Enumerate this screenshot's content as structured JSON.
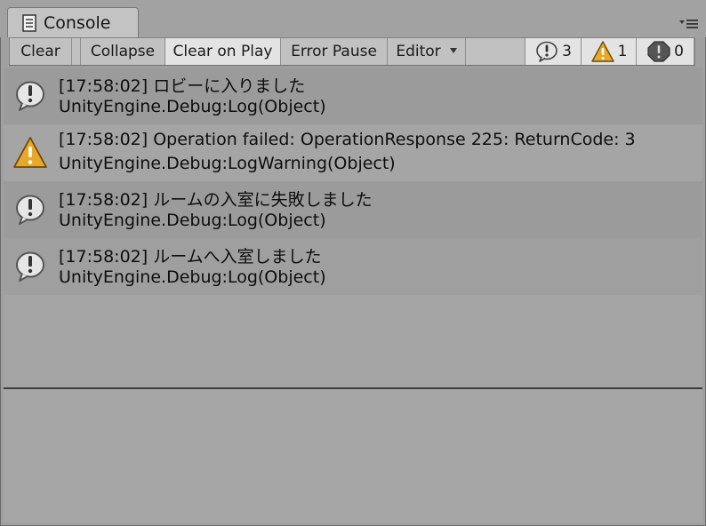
{
  "tab": {
    "title": "Console",
    "icon": "console-document-icon",
    "menu_icon": "tab-menu-icon"
  },
  "toolbar": {
    "clear": "Clear",
    "collapse": "Collapse",
    "clear_on_play": "Clear on Play",
    "error_pause": "Error Pause",
    "editor": "Editor",
    "counts": {
      "info": "3",
      "warning": "1",
      "error": "0"
    }
  },
  "logs": [
    {
      "type": "info",
      "icon": "info-icon",
      "message": "[17:58:02] ロビーに入りました",
      "trace": "UnityEngine.Debug:Log(Object)"
    },
    {
      "type": "warning",
      "icon": "warning-icon",
      "message": "[17:58:02] Operation failed: OperationResponse 225: ReturnCode: 3",
      "trace": "UnityEngine.Debug:LogWarning(Object)"
    },
    {
      "type": "info",
      "icon": "info-icon",
      "message": "[17:58:02] ルームの入室に失敗しました",
      "trace": "UnityEngine.Debug:Log(Object)"
    },
    {
      "type": "info",
      "icon": "info-icon",
      "message": "[17:58:02] ルームへ入室しました",
      "trace": "UnityEngine.Debug:Log(Object)"
    }
  ],
  "colors": {
    "warning": "#e8a92a",
    "error": "#555555",
    "info_bubble": "#e6e6e6",
    "selected_button": "#e3e3e3"
  }
}
